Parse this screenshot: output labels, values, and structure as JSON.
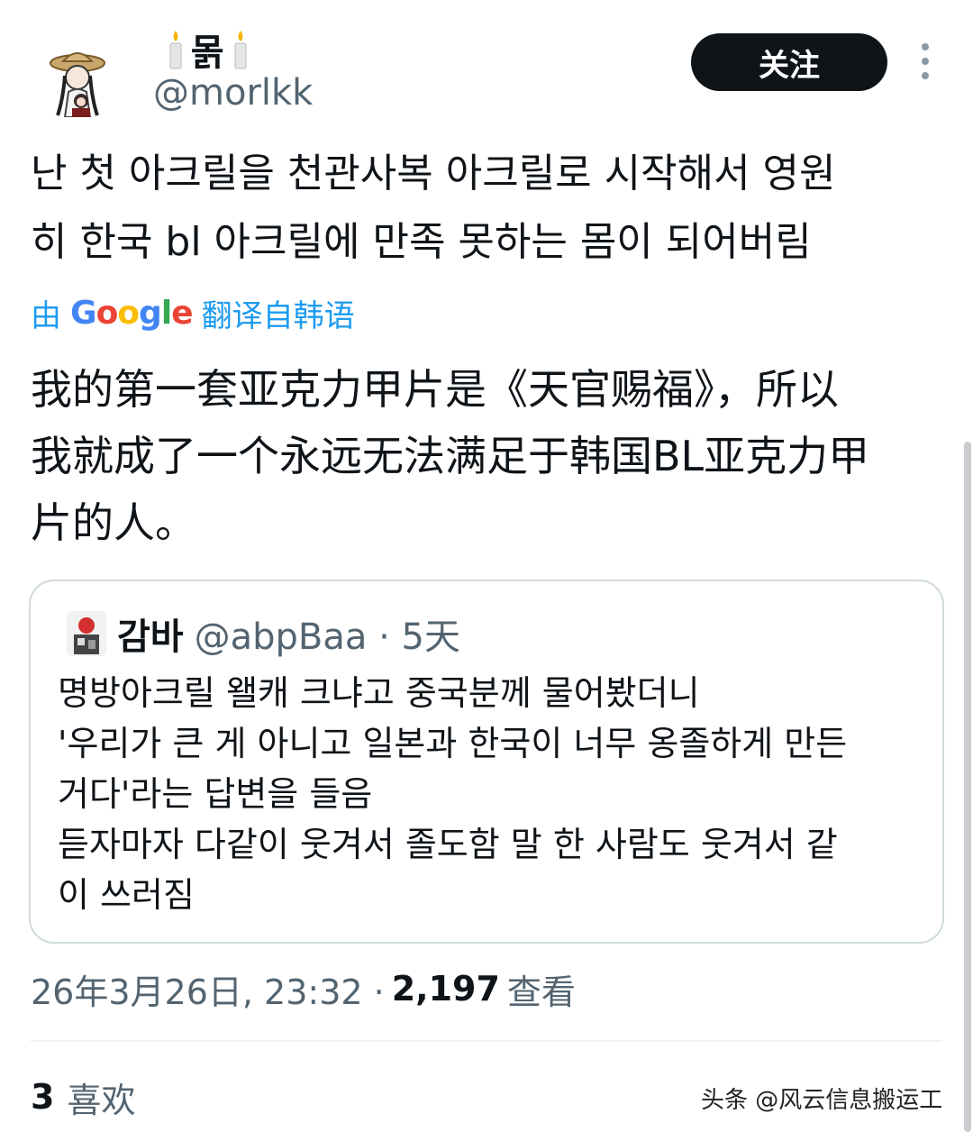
{
  "author": {
    "display_name": "몱",
    "handle": "@morlkk",
    "avatar_icon": "avatar-straw-hat-illustration",
    "candle_icon": "candle-icon"
  },
  "actions": {
    "follow_label": "关注",
    "more_icon": "more-vertical-icon"
  },
  "tweet": {
    "text": "난 첫 아크릴을 천관사복 아크릴로 시작해서 영원\n히 한국 bl 아크릴에 만족 못하는 몸이 되어버림",
    "translate_prefix": "由",
    "translate_brand": "Google",
    "translate_suffix": "翻译自韩语",
    "translated_text": "我的第一套亚克力甲片是《天官赐福》，所以\n我就成了一个永远无法满足于韩国BL亚克力甲\n片的人。"
  },
  "quote": {
    "display_name": "감바",
    "handle": "@abpBaa",
    "meta": "@abpBaa · 5天",
    "text": "명방아크릴 왤캐 크냐고 중국분께 물어봤더니\n'우리가 큰 게 아니고 일본과 한국이 너무 옹졸하게 만든\n거다'라는 답변을 들음\n듣자마자 다같이 웃겨서 졸도함 말 한 사람도 웃겨서 같\n이 쓰러짐"
  },
  "footer": {
    "timestamp": "26年3月26日, 23:32 ·",
    "views_count": "2,197",
    "views_label": "查看",
    "likes_count": "3",
    "likes_label": "喜欢"
  },
  "watermark": "头条 @风云信息搬运工"
}
